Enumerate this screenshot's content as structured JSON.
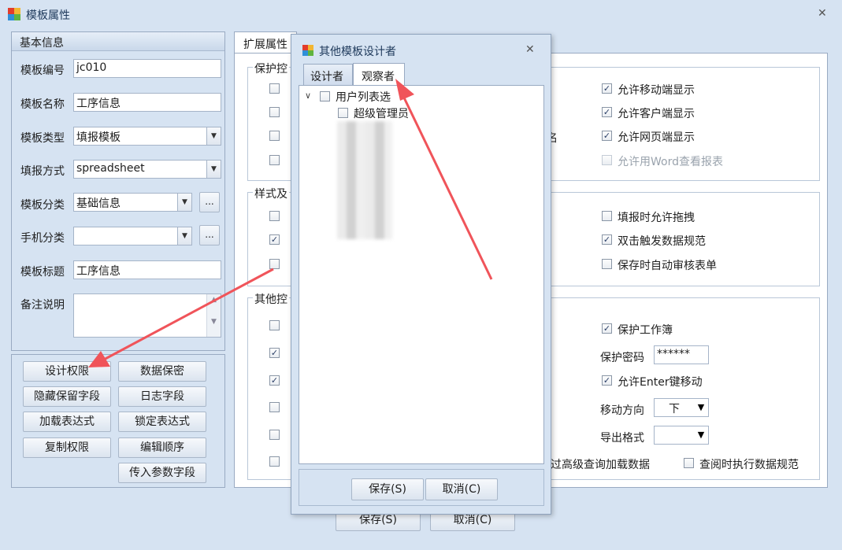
{
  "window": {
    "title": "模板属性",
    "close": "✕"
  },
  "basic": {
    "header": "基本信息",
    "fields": {
      "code_label": "模板编号",
      "code_value": "jc010",
      "name_label": "模板名称",
      "name_value": "工序信息",
      "type_label": "模板类型",
      "type_value": "填报模板",
      "fill_label": "填报方式",
      "fill_value": "spreadsheet",
      "cat_label": "模板分类",
      "cat_value": "基础信息",
      "mobile_label": "手机分类",
      "mobile_value": "",
      "title_label": "模板标题",
      "title_value": "工序信息",
      "note_label": "备注说明"
    },
    "buttons": [
      "设计权限",
      "数据保密",
      "隐藏保留字段",
      "日志字段",
      "加载表达式",
      "锁定表达式",
      "复制权限",
      "编辑顺序",
      "传入参数字段"
    ],
    "ellipsis": "..."
  },
  "ext": {
    "tab": "扩展属性",
    "g1_label": "保护控",
    "g2_label": "样式及",
    "g3_label": "其他控",
    "right1": [
      {
        "label": "允许移动端显示",
        "checked": true,
        "disabled": false
      },
      {
        "label": "允许客户端显示",
        "checked": true,
        "disabled": false
      },
      {
        "label": "允许网页端显示",
        "checked": true,
        "disabled": false
      },
      {
        "label": "允许用Word查看报表",
        "checked": false,
        "disabled": true
      }
    ],
    "right2": [
      {
        "label": "填报时允许拖拽",
        "checked": false
      },
      {
        "label": "双击触发数据规范",
        "checked": true
      },
      {
        "label": "保存时自动审核表单",
        "checked": false
      }
    ],
    "protect_wb": "保护工作簿",
    "pwd_label": "保护密码",
    "pwd_value": "******",
    "enter_move": "允许Enter键移动",
    "move_dir_label": "移动方向",
    "move_dir_value": "下",
    "export_label": "导出格式",
    "export_value": "",
    "adv_query": "过高级查询加载数据",
    "query_rule": "查阅时执行数据规范",
    "trunc_char": "名"
  },
  "footer": {
    "save": "保存(S)",
    "cancel": "取消(C)"
  },
  "dialog": {
    "title": "其他模板设计者",
    "tabs": [
      "设计者",
      "观察者"
    ],
    "root": "用户列表选",
    "item": "超级管理员",
    "save": "保存(S)",
    "cancel": "取消(C)"
  },
  "colors": {
    "arrow": "#f0545a",
    "bg": "#d6e3f2"
  }
}
